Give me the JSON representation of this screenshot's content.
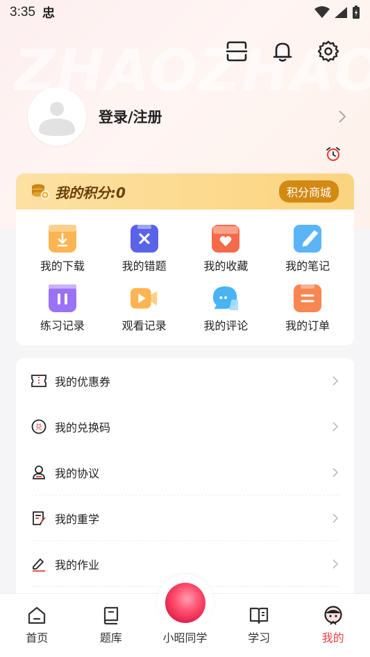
{
  "status_bar": {
    "time": "3:35",
    "app_glyph": "忠"
  },
  "watermark": "ZHAOZHAO",
  "profile": {
    "login_label": "登录/注册"
  },
  "points": {
    "title": "我的积分:0",
    "mall_label": "积分商城"
  },
  "grid": [
    {
      "label": "我的下载",
      "icon": "download-folder-icon",
      "color": "#fbb04c"
    },
    {
      "label": "我的错题",
      "icon": "wrong-question-icon",
      "color": "#5a63e8"
    },
    {
      "label": "我的收藏",
      "icon": "favorite-box-icon",
      "color": "#f56a4b"
    },
    {
      "label": "我的笔记",
      "icon": "notes-icon",
      "color": "#45a9f5"
    },
    {
      "label": "练习记录",
      "icon": "practice-record-icon",
      "color": "#8e6cf4"
    },
    {
      "label": "观看记录",
      "icon": "video-record-icon",
      "color": "#fbb04c"
    },
    {
      "label": "我的评论",
      "icon": "comment-bubble-icon",
      "color": "#45b8f5"
    },
    {
      "label": "我的订单",
      "icon": "order-icon",
      "color": "#f88650"
    }
  ],
  "menu": [
    {
      "label": "我的优惠券",
      "icon": "coupon-icon"
    },
    {
      "label": "我的兑换码",
      "icon": "redeem-code-icon"
    },
    {
      "label": "我的协议",
      "icon": "agreement-icon"
    },
    {
      "label": "我的重学",
      "icon": "relearn-icon"
    },
    {
      "label": "我的作业",
      "icon": "homework-icon"
    }
  ],
  "nav": [
    {
      "label": "首页",
      "icon": "home-icon"
    },
    {
      "label": "题库",
      "icon": "question-bank-icon"
    },
    {
      "label": "小昭同学",
      "icon": "assistant-ball-icon"
    },
    {
      "label": "学习",
      "icon": "study-book-icon"
    },
    {
      "label": "我的",
      "icon": "profile-face-icon",
      "active": true
    }
  ],
  "colors": {
    "accent": "#f23d3d",
    "points_brown": "#6b3d0c",
    "mall_button": "#d38a14"
  }
}
